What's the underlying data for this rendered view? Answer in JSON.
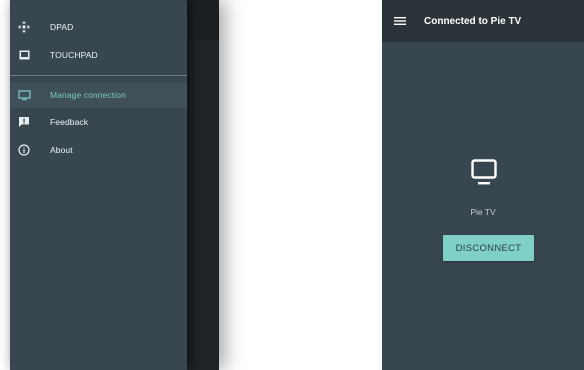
{
  "drawer": {
    "items": [
      {
        "label": "DPAD",
        "icon": "dpad-icon"
      },
      {
        "label": "TOUCHPAD",
        "icon": "touchpad-icon"
      },
      {
        "label": "Manage connection",
        "icon": "tv-icon",
        "selected": true
      },
      {
        "label": "Feedback",
        "icon": "feedback-icon"
      },
      {
        "label": "About",
        "icon": "info-icon"
      }
    ],
    "selected_color": "#79c7c0",
    "background_color": "#38474f"
  },
  "connection": {
    "title": "Connected to Pie TV",
    "device_name": "Pie TV",
    "disconnect_label": "DISCONNECT",
    "accent_color": "#7fd1c7"
  }
}
